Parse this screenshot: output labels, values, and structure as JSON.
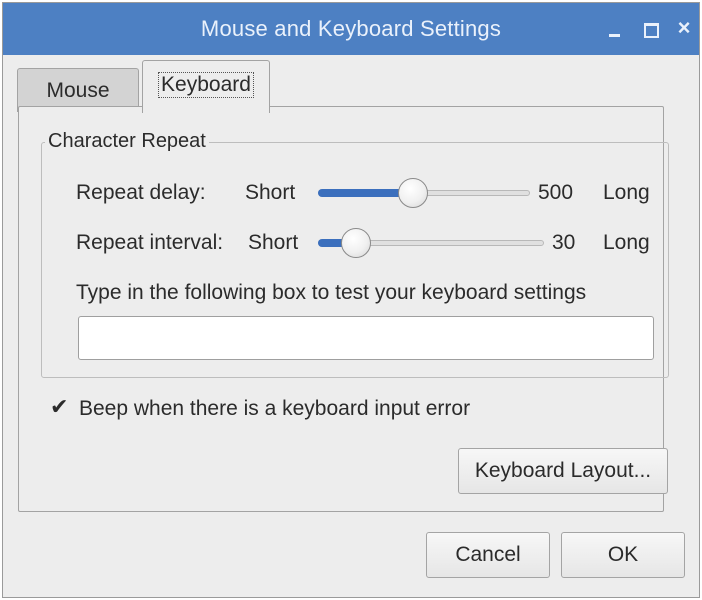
{
  "window": {
    "title": "Mouse and Keyboard Settings",
    "controls": {
      "minimize_icon": "minimize-icon",
      "maximize_icon": "maximize-icon",
      "close": "×"
    }
  },
  "tabs": [
    {
      "label": "Mouse",
      "active": false
    },
    {
      "label": "Keyboard",
      "active": true
    }
  ],
  "character_repeat": {
    "title": "Character Repeat",
    "delay": {
      "label": "Repeat delay:",
      "short": "Short",
      "long": "Long",
      "value": "500",
      "level": 0.45
    },
    "interval": {
      "label": "Repeat interval:",
      "short": "Short",
      "long": "Long",
      "value": "30",
      "level": 0.17
    },
    "test_label": "Type in the following box to test your keyboard settings",
    "test_value": ""
  },
  "beep": {
    "label": "Beep when there is a keyboard input error",
    "checked": true,
    "mark": "✔"
  },
  "buttons": {
    "layout": "Keyboard Layout...",
    "cancel": "Cancel",
    "ok": "OK"
  },
  "colors": {
    "titlebar": "#4d80c3",
    "accent": "#3b6fbd",
    "background": "#ededed"
  }
}
